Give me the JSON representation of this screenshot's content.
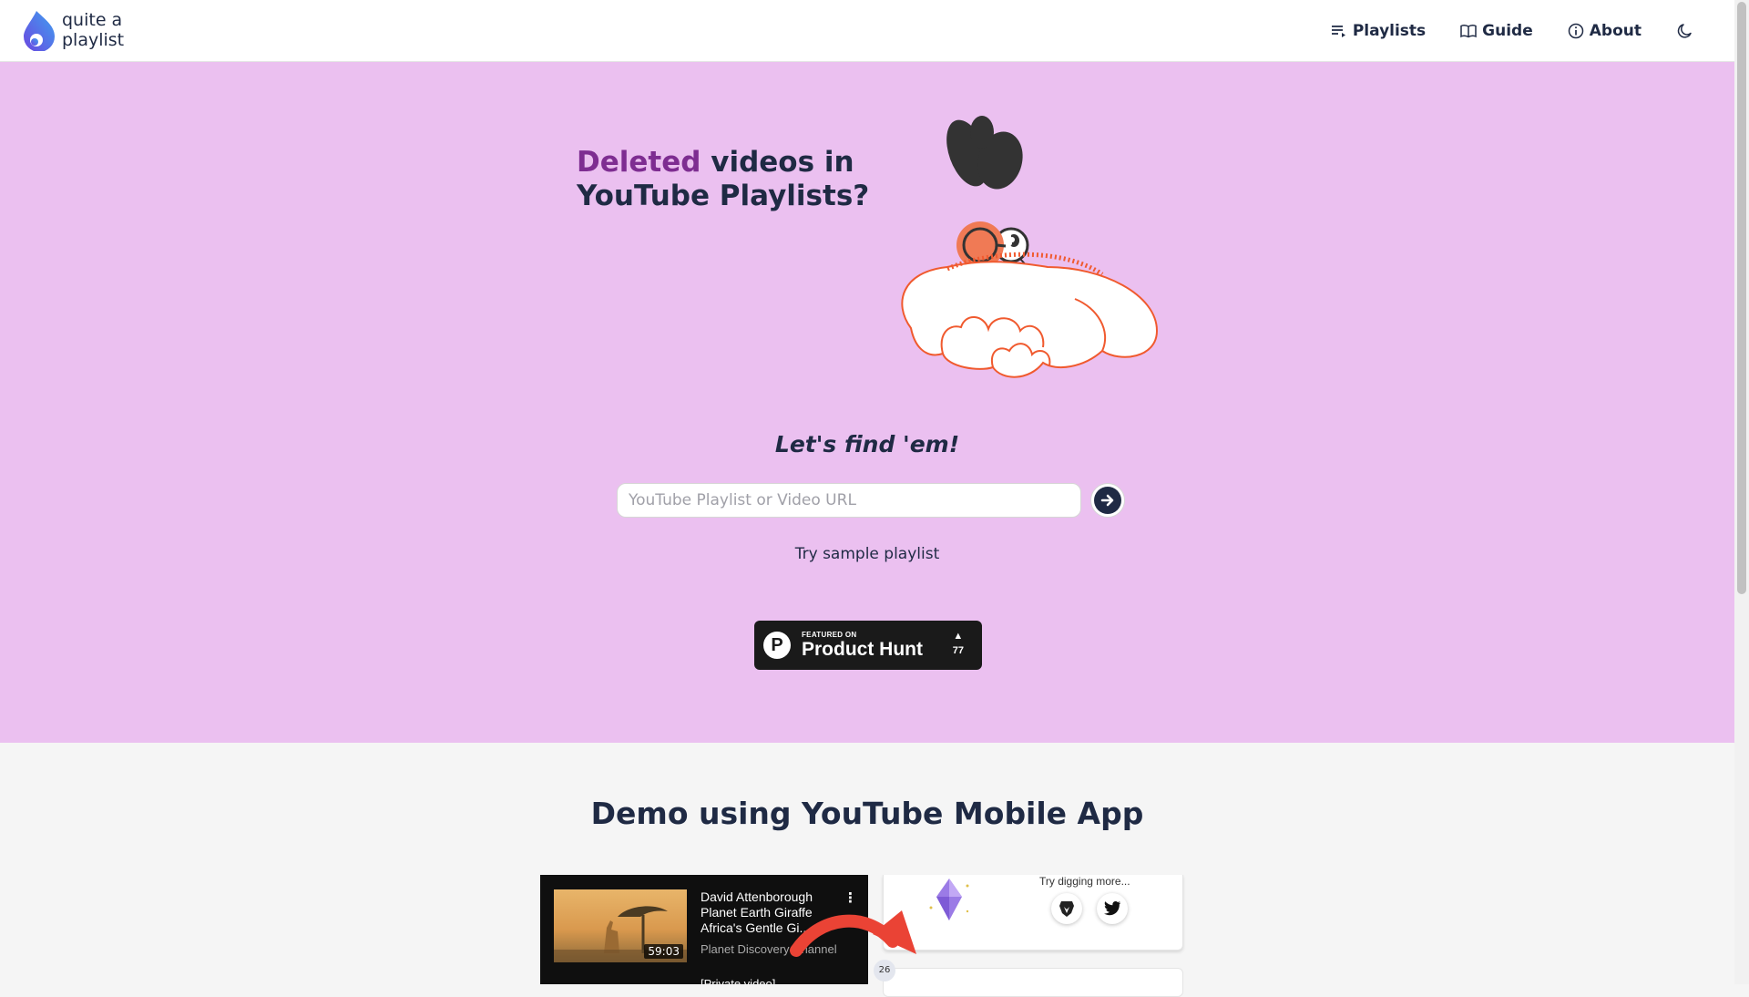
{
  "brand": {
    "name_line1": "quite a",
    "name_line2": "playlist"
  },
  "nav": {
    "playlists": "Playlists",
    "guide": "Guide",
    "about": "About"
  },
  "hero": {
    "headline_accent": "Deleted",
    "headline_rest1": " videos in",
    "headline_line2": "YouTube Playlists?",
    "tagline": "Let's find 'em!",
    "url_placeholder": "YouTube Playlist or Video URL",
    "sample_link": "Try sample playlist"
  },
  "product_hunt": {
    "featured_on": "FEATURED ON",
    "name": "Product Hunt",
    "votes": "77"
  },
  "demo": {
    "title": "Demo using YouTube Mobile App",
    "video_title": "David Attenborough Planet Earth   Giraffe Africa's Gentle Gi...",
    "duration": "59:03",
    "channel": "Planet Discovery Channel",
    "next_title": "[Private video]",
    "dig_more": "Try digging more...",
    "index_number": "26"
  },
  "colors": {
    "hero_bg": "#ebc0f0",
    "accent": "#7e2d91",
    "text": "#1f2a44",
    "arrow": "#ea4335"
  }
}
